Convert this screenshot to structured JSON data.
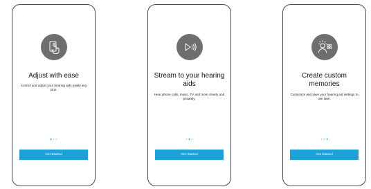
{
  "screens": [
    {
      "icon": "hand-tap-phone-icon",
      "title": "Adjust with ease",
      "description": "Control and adjust your hearing aids easily any time.",
      "page_index": 0,
      "button_label": "Get Started"
    },
    {
      "icon": "stream-play-icon",
      "title": "Stream to your hearing aids",
      "description": "Hear phone calls, music, TV and more clearly and privately.",
      "page_index": 1,
      "button_label": "Get Started"
    },
    {
      "icon": "custom-memories-icon",
      "title": "Create custom memories",
      "description": "Customize and save your hearing aid settings to use later.",
      "page_index": 2,
      "button_label": "Get Started"
    }
  ],
  "page_count": 3,
  "colors": {
    "accent": "#1ea0d8",
    "icon_background": "#6e6e6e",
    "dot_inactive": "#cfcfcf"
  }
}
